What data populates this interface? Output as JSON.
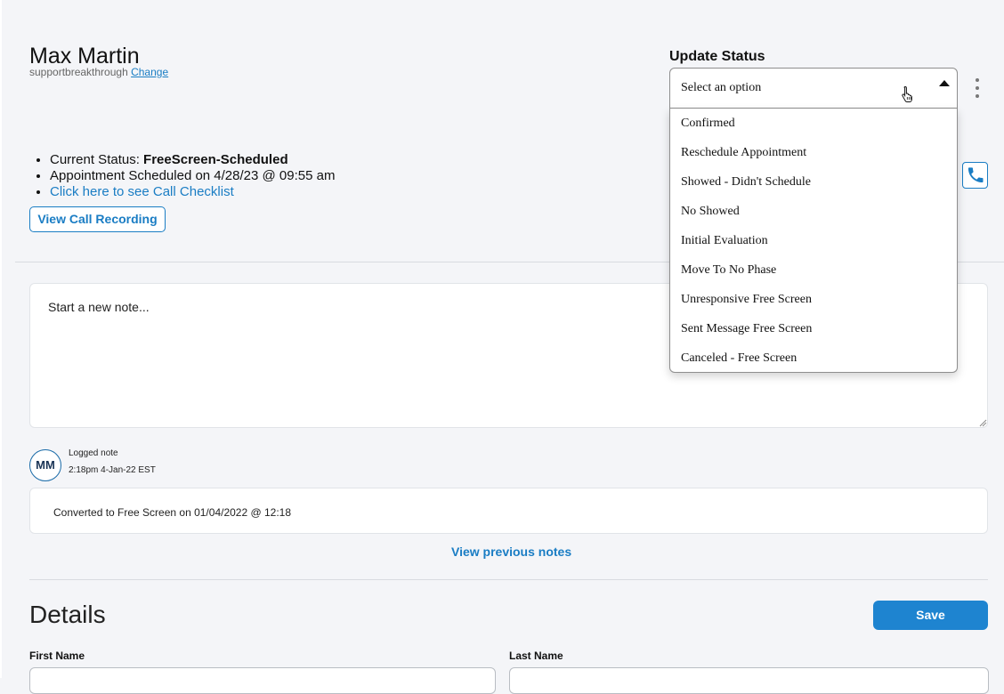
{
  "contact": {
    "name": "Max Martin",
    "account": "supportbreakthrough",
    "change_link": "Change"
  },
  "status_info": {
    "current_label": "Current Status: ",
    "current_value": "FreeScreen-Scheduled",
    "appointment": "Appointment Scheduled on 4/28/23 @ 09:55 am",
    "checklist_link": "Click here to see Call Checklist",
    "recording_button": "View Call Recording"
  },
  "notes": {
    "placeholder": "Start a new note...",
    "entry": {
      "avatar_initials": "MM",
      "label": "Logged note",
      "time": "2:18pm 4-Jan-22 EST",
      "text": "Converted to Free Screen on 01/04/2022 @ 12:18"
    },
    "view_previous": "View previous notes"
  },
  "details": {
    "title": "Details",
    "save_label": "Save",
    "first_name_label": "First Name",
    "last_name_label": "Last Name"
  },
  "update_status": {
    "title": "Update Status",
    "selected": "Select an option",
    "options": [
      "Confirmed",
      "Reschedule Appointment",
      "Showed - Didn't Schedule",
      "No Showed",
      "Initial Evaluation",
      "Move To No Phase",
      "Unresponsive Free Screen",
      "Sent Message Free Screen",
      "Canceled - Free Screen"
    ]
  },
  "icons": {
    "kebab": "more-vertical-icon",
    "phone": "phone-icon",
    "cursor": "hand-pointer-icon",
    "caret": "caret-up-icon"
  },
  "colors": {
    "accent": "#1a7dc4",
    "save_button": "#1e84d0",
    "background": "#f4f5f8"
  }
}
